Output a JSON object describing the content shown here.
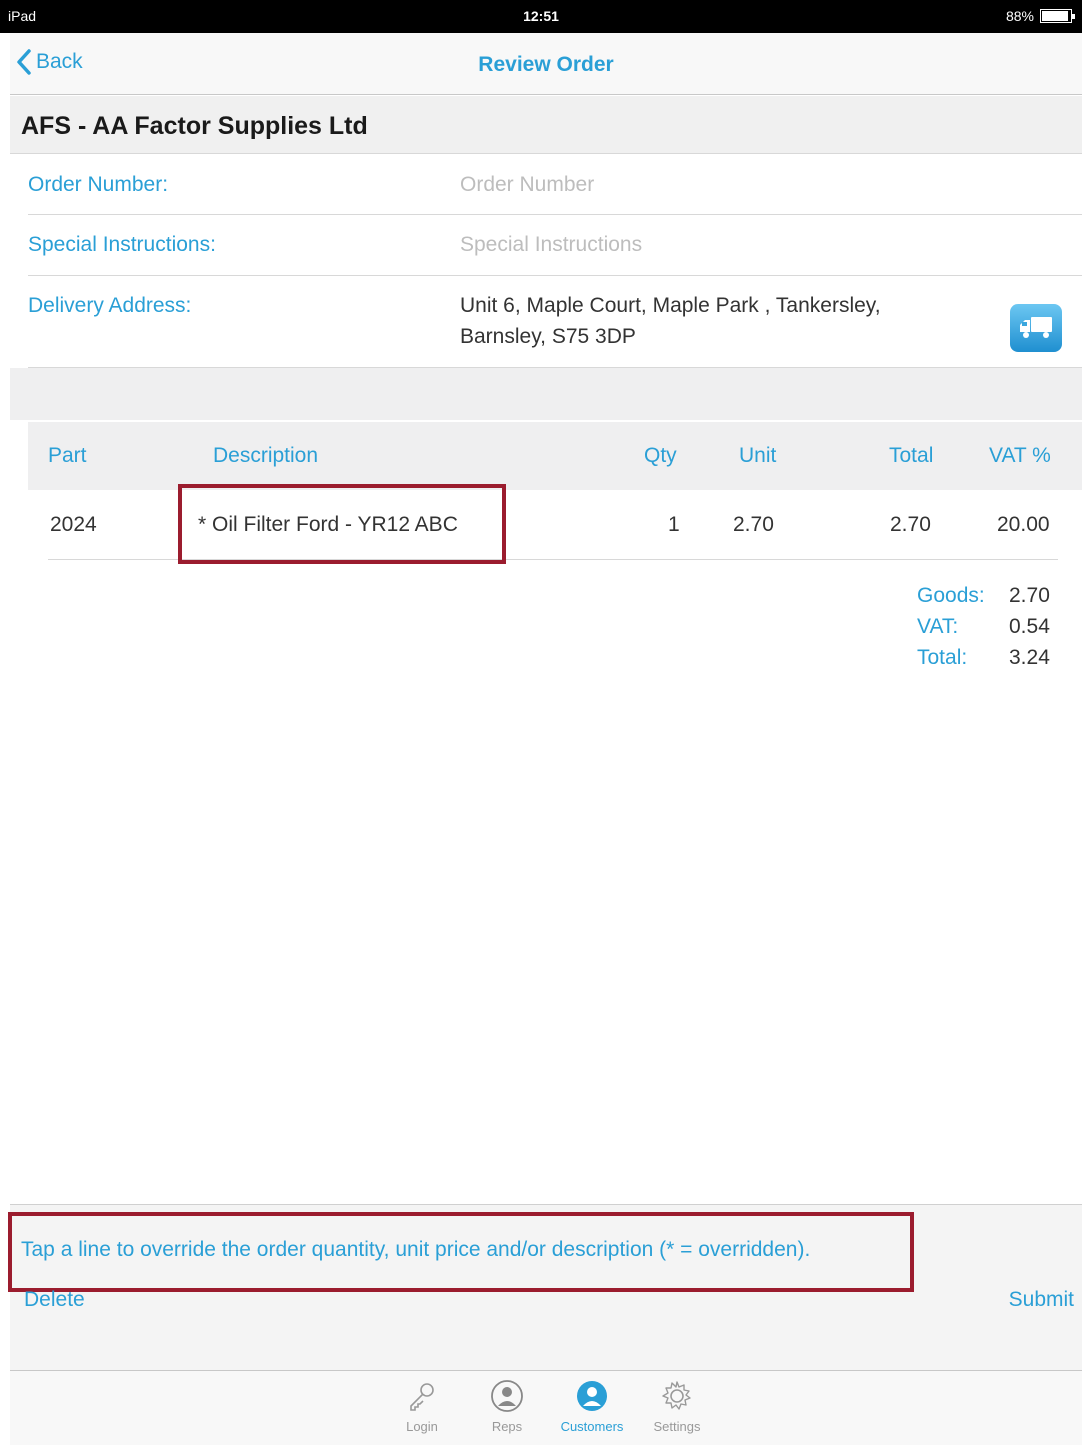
{
  "status": {
    "device": "iPad",
    "time": "12:51",
    "battery": "88%"
  },
  "nav": {
    "back_label": "Back",
    "title": "Review Order"
  },
  "customer": {
    "name": "AFS - AA Factor Supplies Ltd"
  },
  "form": {
    "order_number": {
      "label": "Order Number:",
      "placeholder": "Order Number"
    },
    "special_instructions": {
      "label": "Special Instructions:",
      "placeholder": "Special Instructions"
    },
    "delivery_address": {
      "label": "Delivery Address:",
      "line1": "Unit 6, Maple Court, Maple Park , Tankersley,",
      "line2": "Barnsley, S75 3DP"
    }
  },
  "table": {
    "headers": {
      "part": "Part",
      "description": "Description",
      "qty": "Qty",
      "unit": "Unit",
      "total": "Total",
      "vat": "VAT %"
    },
    "rows": [
      {
        "part": "2024",
        "description": "* Oil Filter Ford - YR12 ABC",
        "qty": "1",
        "unit": "2.70",
        "total": "2.70",
        "vat": "20.00"
      }
    ]
  },
  "totals": {
    "goods_label": "Goods:",
    "goods_value": "2.70",
    "vat_label": "VAT:",
    "vat_value": "0.54",
    "total_label": "Total:",
    "total_value": "3.24"
  },
  "footer": {
    "hint": "Tap a line to override the order quantity, unit price and/or description (* = overridden).",
    "delete_label": "Delete",
    "submit_label": "Submit"
  },
  "tabs": [
    {
      "label": "Login",
      "icon": "key-icon",
      "active": false
    },
    {
      "label": "Reps",
      "icon": "person-icon",
      "active": false
    },
    {
      "label": "Customers",
      "icon": "customers-icon",
      "active": true
    },
    {
      "label": "Settings",
      "icon": "gear-icon",
      "active": false
    }
  ],
  "colors": {
    "accent": "#2a9fd6",
    "highlight_border": "#9b1c2e"
  }
}
